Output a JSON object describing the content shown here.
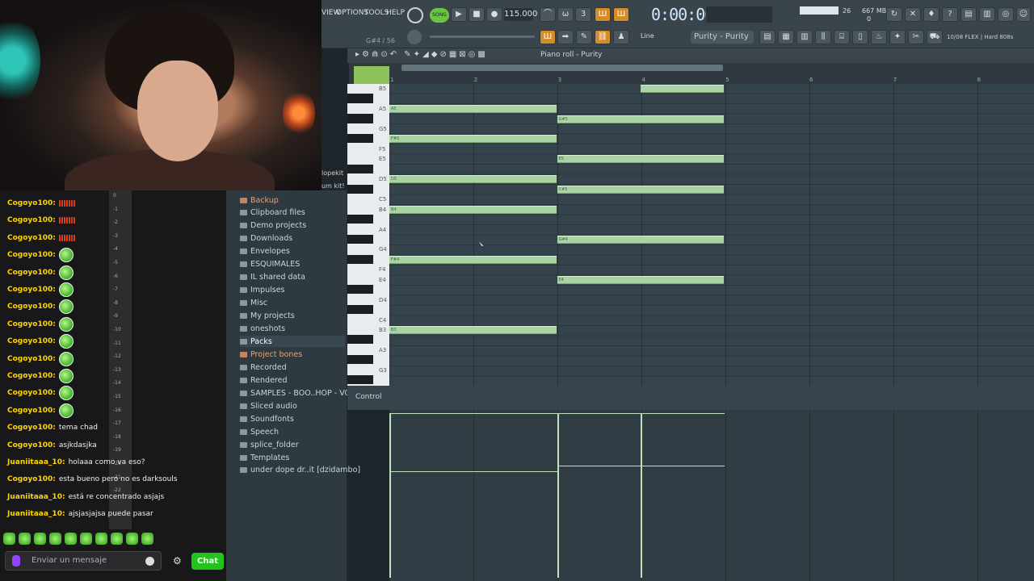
{
  "toolbar": {
    "menus": [
      "VIEW",
      "OPTIONS",
      "TOOLS",
      "HELP"
    ],
    "song_button": "SONG",
    "tempo": "115.000",
    "time": "0:00:00",
    "hint": "G#4 / 56",
    "cpu": "26",
    "memory": "667 MB",
    "memory_sub": "0",
    "snap": "Line",
    "pattern": "Purity - Purity",
    "plugin": "10/08 FLEX | Hard 808s"
  },
  "piano_roll": {
    "title": "Piano roll - Purity",
    "bar_numbers": [
      "1",
      "2",
      "3",
      "4",
      "5",
      "6",
      "7",
      "8"
    ],
    "key_labels": [
      "B5",
      "A5",
      "G5",
      "F5",
      "E5",
      "D5",
      "C5",
      "B4",
      "A4",
      "G4",
      "F4",
      "E4",
      "D4",
      "C4",
      "B3",
      "A3",
      "G3"
    ],
    "notes": [
      {
        "label": "A5",
        "pitch": "A5",
        "start": 1,
        "length": 2
      },
      {
        "label": "F#5",
        "pitch": "F#5",
        "start": 1,
        "length": 2
      },
      {
        "label": "D5",
        "pitch": "D5",
        "start": 1,
        "length": 2
      },
      {
        "label": "B4",
        "pitch": "B4",
        "start": 1,
        "length": 2
      },
      {
        "label": "F#4",
        "pitch": "F#4",
        "start": 1,
        "length": 2
      },
      {
        "label": "B3",
        "pitch": "B3",
        "start": 1,
        "length": 2
      },
      {
        "label": "",
        "pitch": "B5",
        "start": 4,
        "length": 1
      },
      {
        "label": "G#5",
        "pitch": "G#5",
        "start": 3,
        "length": 2
      },
      {
        "label": "E5",
        "pitch": "E5",
        "start": 3,
        "length": 2
      },
      {
        "label": "C#5",
        "pitch": "C#5",
        "start": 3,
        "length": 2
      },
      {
        "label": "G#4",
        "pitch": "G#4",
        "start": 3,
        "length": 2
      },
      {
        "label": "E4",
        "pitch": "E4",
        "start": 3,
        "length": 2
      }
    ],
    "control_label": "Control"
  },
  "browser": {
    "items": [
      {
        "label": "Backup",
        "style": "orange"
      },
      {
        "label": "Clipboard files",
        "style": "normal"
      },
      {
        "label": "Demo projects",
        "style": "normal"
      },
      {
        "label": "Downloads",
        "style": "normal"
      },
      {
        "label": "Envelopes",
        "style": "normal"
      },
      {
        "label": "ESQUIMALES",
        "style": "normal"
      },
      {
        "label": "IL shared data",
        "style": "normal"
      },
      {
        "label": "Impulses",
        "style": "normal"
      },
      {
        "label": "Misc",
        "style": "normal"
      },
      {
        "label": "My projects",
        "style": "normal"
      },
      {
        "label": "oneshots",
        "style": "normal"
      },
      {
        "label": "Packs",
        "style": "selected"
      },
      {
        "label": "Project bones",
        "style": "orange"
      },
      {
        "label": "Recorded",
        "style": "normal"
      },
      {
        "label": "Rendered",
        "style": "normal"
      },
      {
        "label": "SAMPLES - BOO..HOP - VOL 1",
        "style": "normal"
      },
      {
        "label": "Sliced audio",
        "style": "normal"
      },
      {
        "label": "Soundfonts",
        "style": "normal"
      },
      {
        "label": "Speech",
        "style": "normal"
      },
      {
        "label": "splice_folder",
        "style": "normal"
      },
      {
        "label": "Templates",
        "style": "normal"
      },
      {
        "label": "under dope dr..it [dzidambo]",
        "style": "normal"
      }
    ],
    "fragments": [
      "lopekit",
      "um kit!"
    ]
  },
  "chat": {
    "messages": [
      {
        "user": "Cogoyo100",
        "type": "bars",
        "text": ""
      },
      {
        "user": "Cogoyo100",
        "type": "bars",
        "text": ""
      },
      {
        "user": "Cogoyo100",
        "type": "bars",
        "text": ""
      },
      {
        "user": "Cogoyo100",
        "type": "emote",
        "text": ""
      },
      {
        "user": "Cogoyo100",
        "type": "emote",
        "text": ""
      },
      {
        "user": "Cogoyo100",
        "type": "emote",
        "text": ""
      },
      {
        "user": "Cogoyo100",
        "type": "emote",
        "text": ""
      },
      {
        "user": "Cogoyo100",
        "type": "emote",
        "text": ""
      },
      {
        "user": "Cogoyo100",
        "type": "emote",
        "text": ""
      },
      {
        "user": "Cogoyo100",
        "type": "emote",
        "text": ""
      },
      {
        "user": "Cogoyo100",
        "type": "emote",
        "text": ""
      },
      {
        "user": "Cogoyo100",
        "type": "emote",
        "text": ""
      },
      {
        "user": "Cogoyo100",
        "type": "emote",
        "text": ""
      },
      {
        "user": "Cogoyo100",
        "type": "text",
        "text": "tema chad"
      },
      {
        "user": "Cogoyo100",
        "type": "text",
        "text": "asjkdasjka"
      },
      {
        "user": "Juaniitaaa_10",
        "type": "text",
        "text": "holaaa como va eso?"
      },
      {
        "user": "Cogoyo100",
        "type": "text",
        "text": "esta bueno pero no es darksouls"
      },
      {
        "user": "Juaniitaaa_10",
        "type": "text",
        "text": "está re concentrado asjajs"
      },
      {
        "user": "Juaniitaaa_10",
        "type": "text",
        "text": "ajsjasjajsa puede pasar"
      }
    ],
    "meter_ticks": [
      "0",
      "-1",
      "-2",
      "-3",
      "-4",
      "-5",
      "-6",
      "-7",
      "-8",
      "-9",
      "-10",
      "-11",
      "-12",
      "-13",
      "-14",
      "-15",
      "-16",
      "-17",
      "-18",
      "-19",
      "-20",
      "-21",
      "-22"
    ],
    "input_placeholder": "Enviar un mensaje",
    "send_label": "Chat",
    "colors": {
      "cogoyo": "#ffd500",
      "juanita": "#ffd500",
      "accent": "#22c31a"
    }
  }
}
